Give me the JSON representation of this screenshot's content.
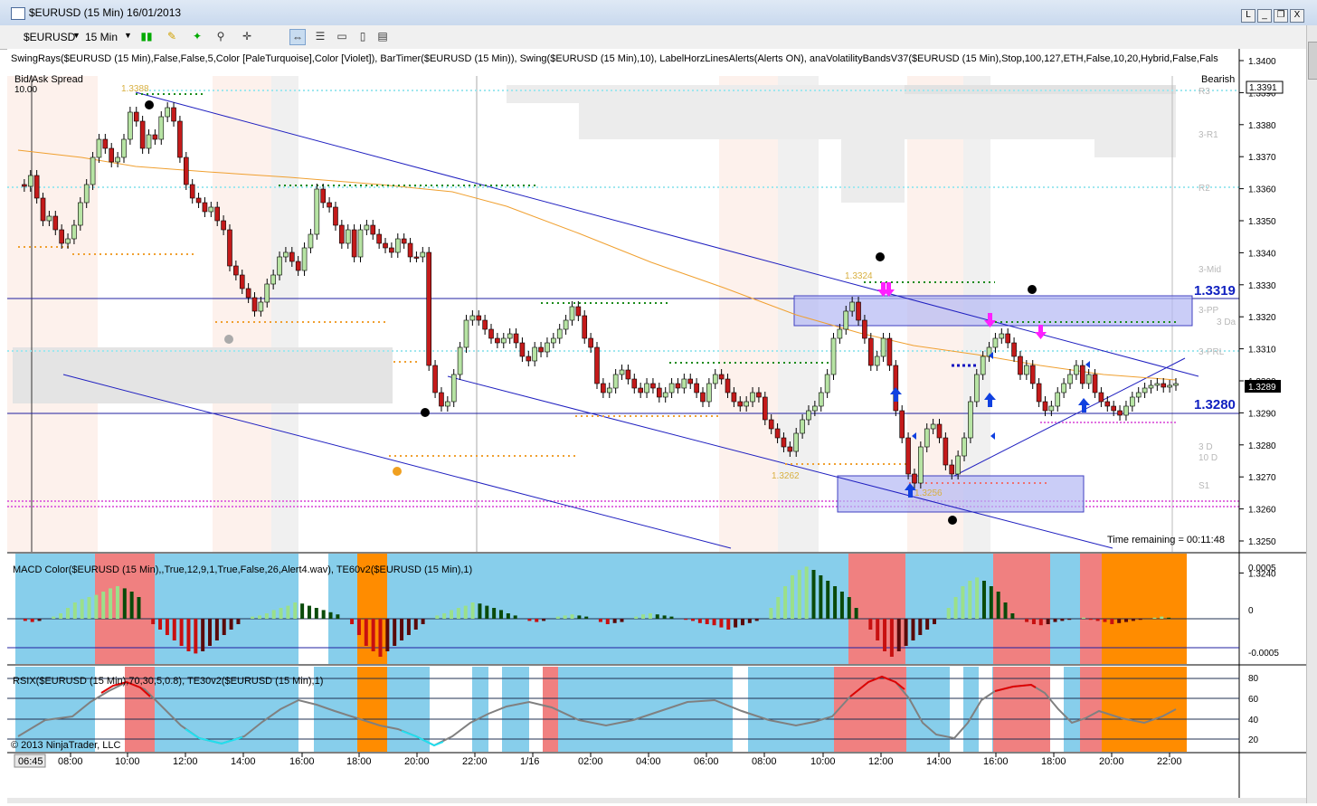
{
  "window": {
    "title": "$EURUSD (15 Min)  16/01/2013",
    "buttons": [
      "L",
      "_",
      "❐",
      "X"
    ]
  },
  "toolbar": {
    "instrument": "$EURUSD",
    "interval": "15 Min"
  },
  "price_panel": {
    "indicator_label": "SwingRays($EURUSD (15 Min),False,False,5,Color [PaleTurquoise],Color [Violet]), BarTimer($EURUSD (15 Min)), Swing($EURUSD (15 Min),10), LabelHorzLinesAlerts(Alerts ON), anaVolatilityBandsV37($EURUSD (15 Min),Stop,100,127,ETH,False,10,20,Hybrid,False,Fals",
    "bid_ask_label": "Bid/Ask Spread",
    "spread_value": "10.00",
    "bearish_label": "Bearish",
    "time_remaining": "Time remaining = 00:11:48",
    "level_1": "1.3319",
    "level_2": "1.3280",
    "current_price": "1.3289",
    "top_price": "1.3391",
    "swing_labels": [
      "1.3388",
      "1.3324",
      "1.3262",
      "1.3256"
    ],
    "pivot_labels": [
      "R3",
      "3-R1",
      "R2",
      "3-Mid",
      "3-PP",
      "3-PRL",
      "S1",
      "3 Da",
      "10 D",
      "3 D"
    ],
    "price_axis": [
      "1.3400",
      "1.3390",
      "1.3380",
      "1.3370",
      "1.3360",
      "1.3350",
      "1.3340",
      "1.3330",
      "1.3320",
      "1.3310",
      "1.3300",
      "1.3290",
      "1.3280",
      "1.3270",
      "1.3260",
      "1.3250",
      "1.3240"
    ]
  },
  "macd_panel": {
    "label": "MACD Color($EURUSD (15 Min),,True,12,9,1,True,False,26,Alert4.wav), TE60v2($EURUSD (15 Min),1)",
    "axis": [
      "0.0005",
      "0",
      "-0.0005"
    ]
  },
  "rsi_panel": {
    "label": "RSIX($EURUSD (15 Min),70,30,5,0.8), TE30v2($EURUSD (15 Min),1)",
    "axis": [
      "80",
      "60",
      "40",
      "20"
    ],
    "copyright": "© 2013 NinjaTrader, LLC"
  },
  "time_axis": {
    "first": "06:45",
    "labels": [
      "08:00",
      "10:00",
      "12:00",
      "14:00",
      "16:00",
      "18:00",
      "20:00",
      "22:00",
      "1/16",
      "02:00",
      "04:00",
      "06:00",
      "08:00",
      "10:00",
      "12:00",
      "14:00",
      "16:00",
      "18:00",
      "20:00",
      "22:00"
    ]
  },
  "colors": {
    "up_candle": "#b7e4a4",
    "down_candle": "#c41a1a",
    "cyan_bg": "#87ceeb",
    "red_bg": "#f08080",
    "orange_bg": "#ff8c00",
    "channel_line": "#2020c0",
    "moving_avg": "#f0a030"
  }
}
